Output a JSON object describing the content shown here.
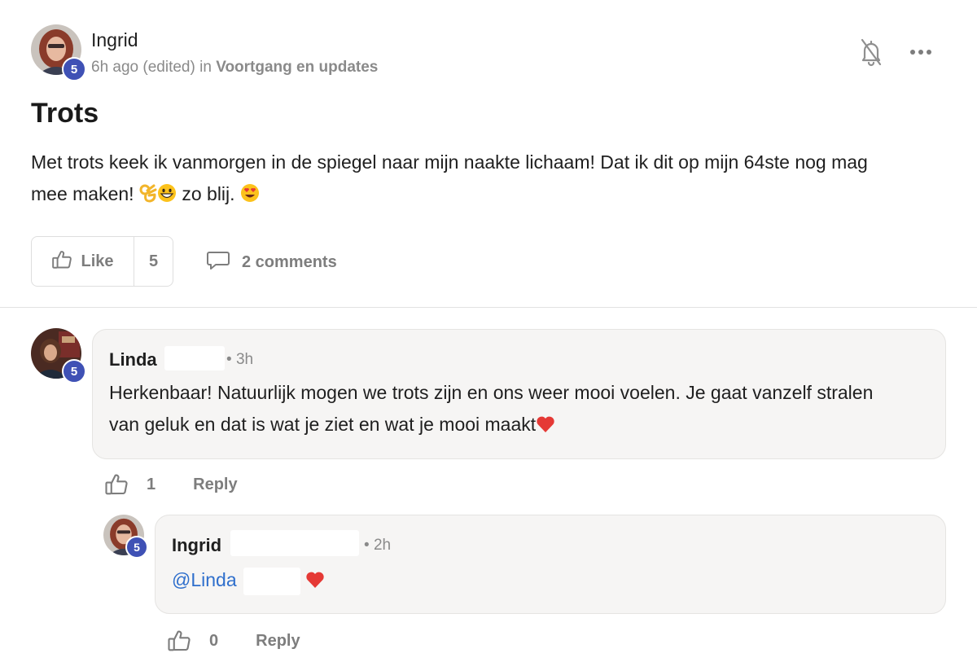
{
  "post": {
    "author": "Ingrid",
    "author_level": "5",
    "time": "6h ago",
    "edited": "(edited)",
    "in_label": "in",
    "category": "Voortgang en updates",
    "title": "Trots",
    "body_line1": "Met trots keek ik vanmorgen in de spiegel naar mijn naakte lichaam! Dat ik dit op mijn 64ste nog mag",
    "body_line2_a": "mee maken!",
    "body_line2_b": "zo blij.",
    "like_label": "Like",
    "like_count": "5",
    "comments_label": "2 comments",
    "icons": {
      "notification": "bell-off-icon",
      "more": "more-horizontal-icon",
      "like": "thumbs-up-icon",
      "comments": "comment-bubble-icon"
    }
  },
  "comments": [
    {
      "author": "Linda",
      "author_level": "5",
      "time": "3h",
      "text_line1": "Herkenbaar! Natuurlijk mogen we trots zijn en ons weer mooi voelen. Je gaat vanzelf stralen",
      "text_line2": "van geluk en dat is wat je ziet en wat je mooi maakt",
      "likes": "1",
      "reply_label": "Reply"
    },
    {
      "author": "Ingrid",
      "author_level": "5",
      "time": "2h",
      "mention": "@Linda",
      "likes": "0",
      "reply_label": "Reply"
    }
  ],
  "colors": {
    "badge": "#3f51b5",
    "mention": "#2f6fcc",
    "bubble": "#f6f5f4",
    "meta": "#8a8a8a",
    "heart": "#e53935"
  }
}
